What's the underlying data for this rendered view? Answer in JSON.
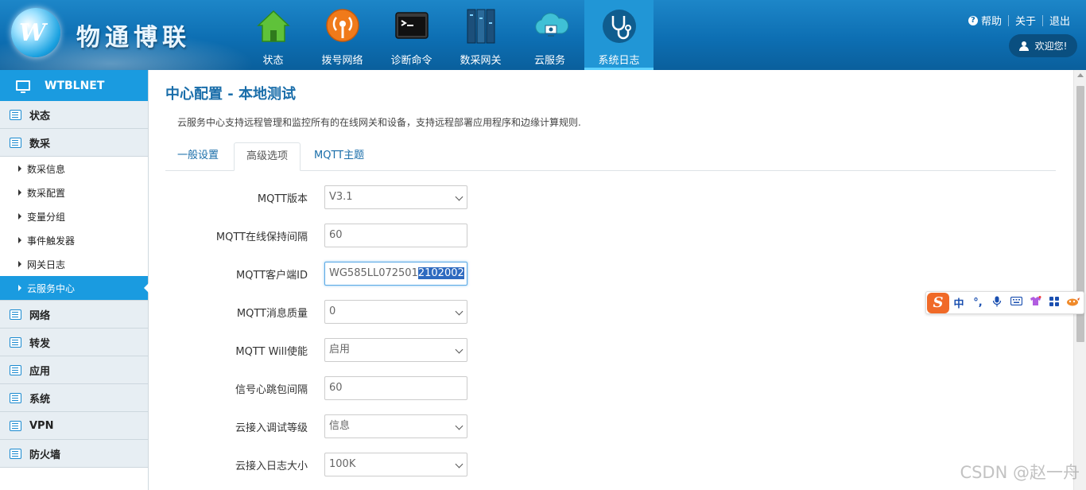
{
  "header": {
    "logo_text": "物通博联",
    "logo_mark": "W",
    "nav": [
      {
        "label": "状态",
        "icon": "house-icon"
      },
      {
        "label": "拨号网络",
        "icon": "broadcast-icon"
      },
      {
        "label": "诊断命令",
        "icon": "terminal-icon"
      },
      {
        "label": "数采网关",
        "icon": "gateway-icon"
      },
      {
        "label": "云服务",
        "icon": "cloud-icon"
      },
      {
        "label": "系统日志",
        "icon": "stethoscope-icon",
        "active": true
      }
    ],
    "links": {
      "help": "帮助",
      "about": "关于",
      "logout": "退出"
    },
    "welcome": "欢迎您!"
  },
  "sidebar": {
    "title": "WTBLNET",
    "groups": [
      {
        "label": "状态"
      },
      {
        "label": "数采",
        "items": [
          "数采信息",
          "数采配置",
          "变量分组",
          "事件触发器",
          "网关日志",
          "云服务中心"
        ],
        "active_item": "云服务中心"
      },
      {
        "label": "网络"
      },
      {
        "label": "转发"
      },
      {
        "label": "应用"
      },
      {
        "label": "系统"
      },
      {
        "label": "VPN"
      },
      {
        "label": "防火墙"
      }
    ]
  },
  "main": {
    "title": "中心配置 - 本地测试",
    "description": "云服务中心支持远程管理和监控所有的在线网关和设备，支持远程部署应用程序和边缘计算规则.",
    "tabs": [
      {
        "label": "一般设置"
      },
      {
        "label": "高级选项",
        "active": true
      },
      {
        "label": "MQTT主题"
      }
    ],
    "form": [
      {
        "label": "MQTT版本",
        "type": "select",
        "value": "V3.1"
      },
      {
        "label": "MQTT在线保持间隔",
        "type": "input",
        "value": "60"
      },
      {
        "label": "MQTT客户端ID",
        "type": "input",
        "value_plain": "WG585LL072501",
        "value_selected": "2102002"
      },
      {
        "label": "MQTT消息质量",
        "type": "select",
        "value": "0"
      },
      {
        "label": "MQTT Will使能",
        "type": "select",
        "value": "启用"
      },
      {
        "label": "信号心跳包间隔",
        "type": "input",
        "value": "60"
      },
      {
        "label": "云接入调试等级",
        "type": "select",
        "value": "信息"
      },
      {
        "label": "云接入日志大小",
        "type": "select",
        "value": "100K"
      }
    ]
  },
  "ime": {
    "logo": "S",
    "mode": "中",
    "punct": "°,"
  },
  "watermark": "CSDN @赵一舟",
  "colors": {
    "header": "#0d6fb3",
    "accent": "#1a9be0",
    "title": "#1a6eaa"
  }
}
